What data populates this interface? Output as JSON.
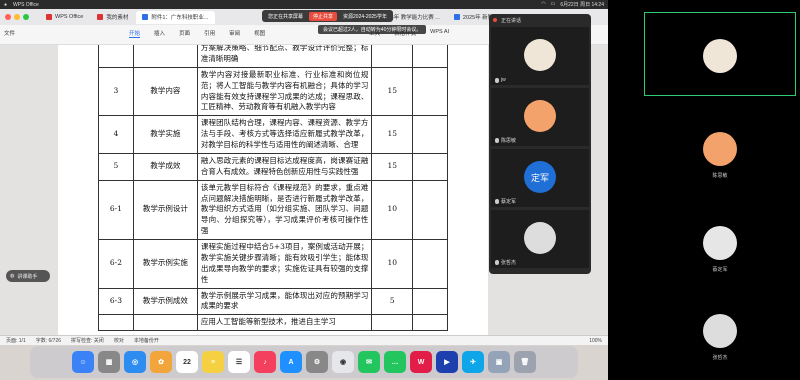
{
  "menubar": {
    "app": "WPS Office",
    "time": "6月22日 周日 14:24"
  },
  "tabs": [
    {
      "label": "WPS Office",
      "color": "#d33"
    },
    {
      "label": "我的素材",
      "color": "#d33"
    },
    {
      "label": "附件1：广东科技职业...",
      "color": "#2e6ee6"
    },
    {
      "label": "2025年 教学能力比赛 ...",
      "color": "#2e6ee6"
    },
    {
      "label": "2025年 新智慧 说课 说用 ...",
      "color": "#2e6ee6"
    }
  ],
  "meeting_banner": {
    "title": "您正在共享屏幕",
    "share_label": "停止共享",
    "extra": "资源2024-2025学年"
  },
  "ribbon": {
    "file": "文件",
    "menus": [
      "开始",
      "插入",
      "页面",
      "引用",
      "审阅",
      "视图",
      "工具",
      "会员专享",
      "效率",
      "表格工具",
      "表格样式",
      "WPS AI"
    ],
    "active": "开始"
  },
  "notice": "会议已超过2人，自动转为40分钟限时会议。",
  "table_rows": [
    {
      "num": "",
      "item": "",
      "req": "方案解决策略、细节配点、教学设计评价完整；标准清晰明确",
      "score": ""
    },
    {
      "num": "3",
      "item": "教学内容",
      "req": "教学内容对接最新职业标准、行业标准和岗位规范；将人工智能与教学内容有机融合；具体的学习内容能有效支持课程学习成果的达成；课程思政、工匠精神、劳动教育等有机融入教学内容",
      "score": "15"
    },
    {
      "num": "4",
      "item": "教学实施",
      "req": "课程团队结构合理，课程内容、课程资源、教学方法与手段、考核方式等选择适应新履式教学改革，对教学目标的科学性与适用性的阐述清晰、合理",
      "score": "15"
    },
    {
      "num": "5",
      "item": "教学成效",
      "req": "融入思政元素的课程目标达成程度高，岗课赛证融合育人有成效。课程特色创新应用性与实践性强",
      "score": "15"
    },
    {
      "num": "6-1",
      "item": "教学示例设计",
      "req": "该单元教学目标符合《课程规范》的要求，重点难点问题解决措施明晰，是否进行新履式教学改革，教学组织方式适用（如分组实施、团队学习、问题导向、分组探究等），学习成果评价考核可操作性强",
      "score": "10"
    },
    {
      "num": "6-2",
      "item": "教学示例实施",
      "req": "课程实施过程中结合5+3项目，案例或活动开展；教学实施关键步骤清晰；能有效吸引学生；能体现出成果导向教学的要求；实施佐证具有较强的支撑性",
      "score": "10"
    },
    {
      "num": "6-3",
      "item": "教学示例成效",
      "req": "教学示例展示学习成果，能体现出对应的预期学习成果的要求",
      "score": "5"
    },
    {
      "num": "",
      "item": "",
      "req": "应用人工智能等新型技术，推进自主学习",
      "score": ""
    }
  ],
  "statusbar": {
    "page": "页面: 1/1",
    "words": "字数: 6/726",
    "spell": "拼写检查: 关闭",
    "proof": "校对",
    "compat": "本地备份开",
    "zoom": "100%"
  },
  "meeting_panel": {
    "status": "正在讲话",
    "participants": [
      {
        "name": "jw",
        "color": "#f0e6d8"
      },
      {
        "name": "陈思敏",
        "color": "#f4a26b"
      },
      {
        "name": "蔡定军",
        "color": "#1f6fd6",
        "initials": "定军"
      },
      {
        "name": "张哲杰",
        "color": "#ddd"
      }
    ]
  },
  "helper": "讲课助手",
  "right_participants": [
    {
      "name": "",
      "color": "#f0e6d8"
    },
    {
      "name": "陈思敏",
      "color": "#f4a26b"
    },
    {
      "name": "蔡定军",
      "color": "#e6e6e6"
    },
    {
      "name": "张哲杰",
      "color": "#ddd"
    }
  ],
  "dock_apps": [
    {
      "name": "finder",
      "color": "#3b82f6",
      "glyph": "☺"
    },
    {
      "name": "launchpad",
      "color": "#888",
      "glyph": "▦"
    },
    {
      "name": "safari",
      "color": "#2d8cf0",
      "glyph": "◎"
    },
    {
      "name": "photos",
      "color": "#f1a53a",
      "glyph": "✿"
    },
    {
      "name": "calendar",
      "color": "#fff",
      "glyph": "22"
    },
    {
      "name": "notes",
      "color": "#f5d142",
      "glyph": "≡"
    },
    {
      "name": "reminders",
      "color": "#fff",
      "glyph": "☰"
    },
    {
      "name": "music",
      "color": "#f43f5e",
      "glyph": "♪"
    },
    {
      "name": "appstore",
      "color": "#1e90ff",
      "glyph": "A"
    },
    {
      "name": "settings",
      "color": "#888",
      "glyph": "⚙"
    },
    {
      "name": "chrome",
      "color": "#e5e7eb",
      "glyph": "◉"
    },
    {
      "name": "wechat",
      "color": "#22c55e",
      "glyph": "✉"
    },
    {
      "name": "messages",
      "color": "#22c55e",
      "glyph": "…"
    },
    {
      "name": "wps",
      "color": "#e11d48",
      "glyph": "W"
    },
    {
      "name": "meeting",
      "color": "#1e40af",
      "glyph": "▶"
    },
    {
      "name": "lark",
      "color": "#0ea5e9",
      "glyph": "✈"
    },
    {
      "name": "preview",
      "color": "#94a3b8",
      "glyph": "▣"
    },
    {
      "name": "trash",
      "color": "#9ca3af",
      "glyph": "🗑"
    }
  ]
}
